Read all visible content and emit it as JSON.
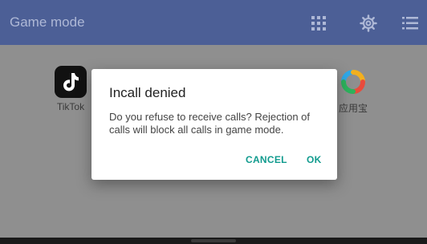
{
  "appbar": {
    "title": "Game mode",
    "icons": [
      "grid-icon",
      "gear-icon",
      "list-icon"
    ],
    "color": "#4c5f96"
  },
  "apps": [
    {
      "label": "TikTok",
      "icon": "tiktok-logo-icon"
    },
    {
      "label": "应用宝",
      "icon": "yingyongbao-logo-icon"
    }
  ],
  "dialog": {
    "title": "Incall denied",
    "message": "Do you refuse to receive calls? Rejection of calls will block all calls in game mode.",
    "cancel_label": "CANCEL",
    "ok_label": "OK",
    "accent": "#119b8e"
  }
}
